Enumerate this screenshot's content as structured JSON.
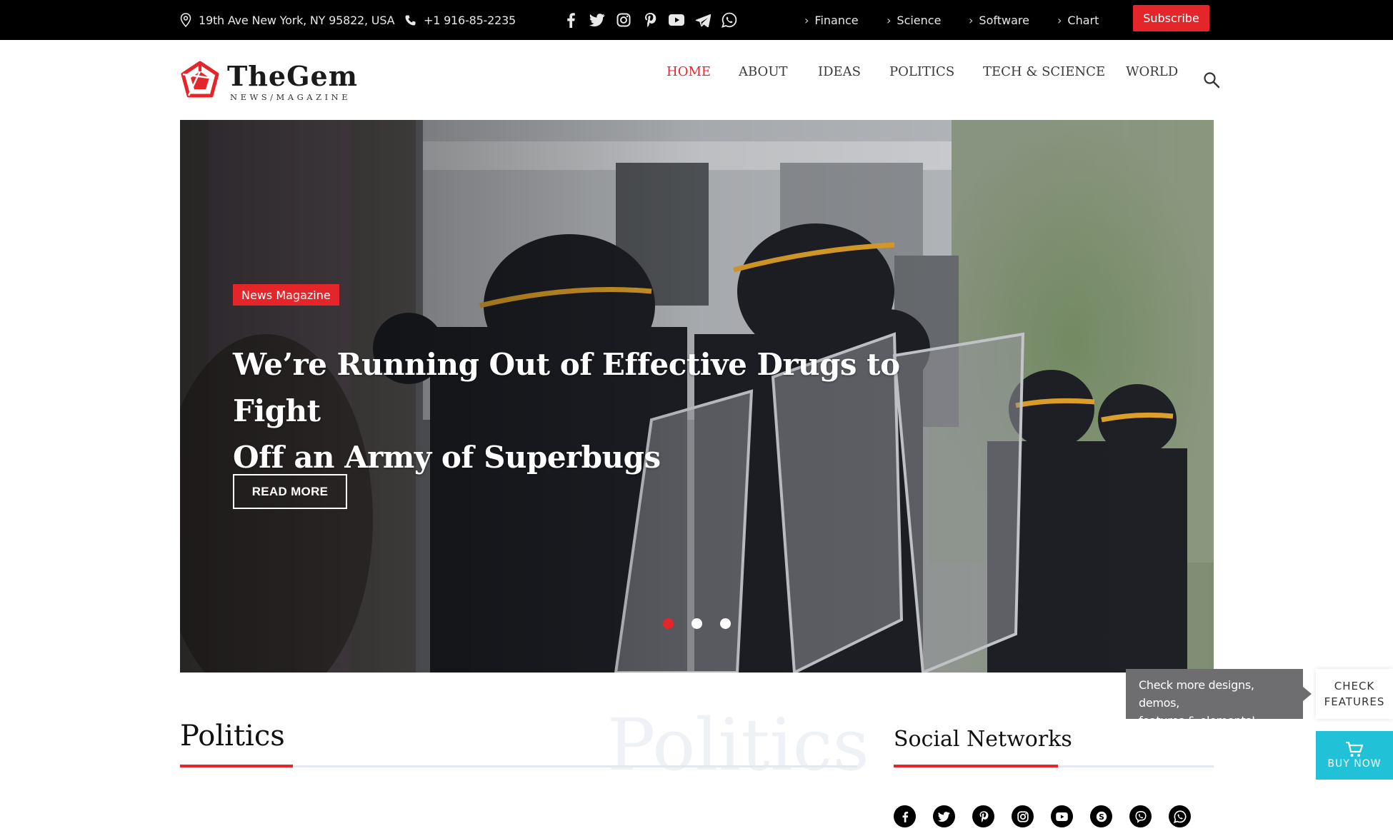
{
  "topbar": {
    "address": "19th Ave New York, NY 95822, USA",
    "phone": "+1 916-85-2235",
    "social_icons": [
      "facebook-icon",
      "twitter-icon",
      "instagram-icon",
      "pinterest-icon",
      "youtube-icon",
      "telegram-icon",
      "whatsapp-icon"
    ],
    "links": [
      "Finance",
      "Science",
      "Software",
      "Chart"
    ],
    "subscribe_label": "Subscribe"
  },
  "header": {
    "logo_title": "TheGem",
    "logo_subtitle": "NEWS/MAGAZINE",
    "nav": [
      "HOME",
      "ABOUT",
      "IDEAS",
      "POLITICS",
      "TECH & SCIENCE",
      "WORLD"
    ],
    "active_nav": "HOME"
  },
  "hero": {
    "badge": "News Magazine",
    "headline_line1": "We’re Running Out of Effective Drugs to Fight",
    "headline_line2": "Off an Army of Superbugs",
    "cta": "READ MORE",
    "slides": 3,
    "active_slide": 1
  },
  "sections": {
    "politics_title": "Politics",
    "politics_ghost": "Politics",
    "social_title": "Social Networks",
    "social_icons": [
      "facebook-icon",
      "twitter-icon",
      "pinterest-icon",
      "instagram-icon",
      "youtube-icon",
      "skype-icon",
      "viber-icon",
      "whatsapp-icon"
    ]
  },
  "promo": {
    "tip_line1": "Check more designs, demos,",
    "tip_line2": "features & elements!",
    "check_line1": "CHECK",
    "check_line2": "FEATURES",
    "buy_label": "BUY NOW"
  },
  "colors": {
    "accent": "#e4262a",
    "topbar_bg": "#000000",
    "buy_bg": "#21c1d8"
  }
}
